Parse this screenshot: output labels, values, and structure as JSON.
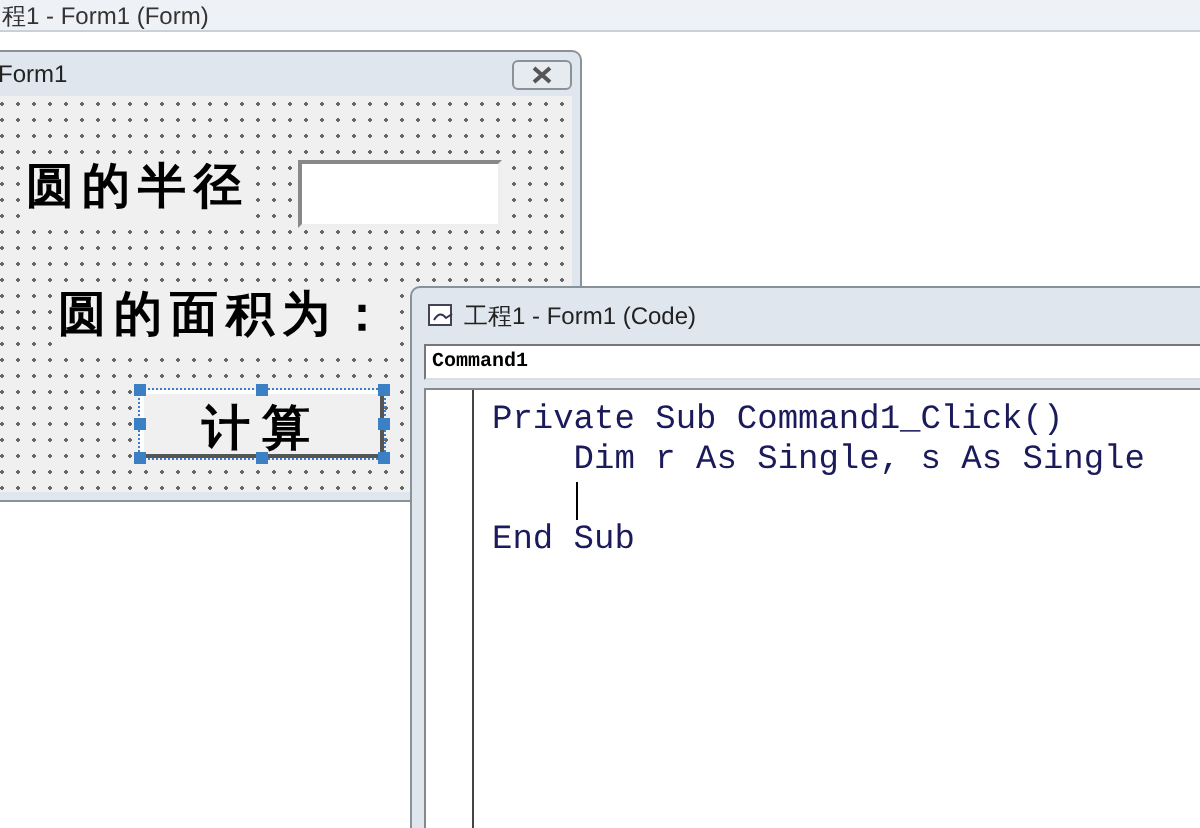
{
  "ide_title": "程1 - Form1 (Form)",
  "form_window": {
    "title": "Form1",
    "radius_label": "圆的半径",
    "area_label": "圆的面积为：",
    "button": {
      "label": "计算",
      "selected": true
    }
  },
  "code_window": {
    "title": "工程1 - Form1 (Code)",
    "object_box": "Command1",
    "lines": [
      {
        "text": "Private Sub Command1_Click()",
        "cursor": false
      },
      {
        "text": "    Dim r As Single, s As Single",
        "cursor": false
      },
      {
        "cursor": true
      },
      {
        "text": "End Sub",
        "cursor": false
      }
    ]
  }
}
